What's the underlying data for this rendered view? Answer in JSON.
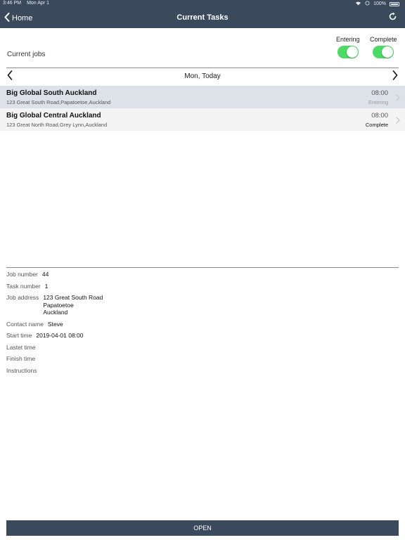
{
  "status_bar": {
    "time": "3:46 PM",
    "date": "Mon Apr 1",
    "battery": "100%"
  },
  "navbar": {
    "back_label": "Home",
    "title": "Current Tasks"
  },
  "filters": {
    "current_jobs_label": "Current jobs",
    "entering_label": "Entering",
    "complete_label": "Complete",
    "entering_on": true,
    "complete_on": true
  },
  "date_nav": {
    "label": "Mon, Today"
  },
  "jobs": [
    {
      "name": "Big Global South Auckland",
      "address": "123 Great South Road,Papatoetoe,Auckland",
      "time": "08:00",
      "status": "Entering"
    },
    {
      "name": "Big Global Central Auckland",
      "address": "123 Great North Road,Grey Lynn,Auckland",
      "time": "08:00",
      "status": "Complete"
    }
  ],
  "details": {
    "job_number_label": "Job number",
    "job_number": "44",
    "task_number_label": "Task number",
    "task_number": "1",
    "job_address_label": "Job address",
    "job_address_lines": [
      "123 Great South Road",
      "Papatoetoe",
      "Auckland"
    ],
    "contact_name_label": "Contact name",
    "contact_name": "Steve",
    "start_time_label": "Start time",
    "start_time": "2019-04-01 08:00",
    "lastet_time_label": "Lastet time",
    "finish_time_label": "Finish time",
    "instructions_label": "Instructions"
  },
  "actions": {
    "open_label": "OPEN"
  },
  "colors": {
    "navbar": "#3a4a5c",
    "toggle_on": "#4cd964",
    "selected_row": "#dde2e8"
  }
}
